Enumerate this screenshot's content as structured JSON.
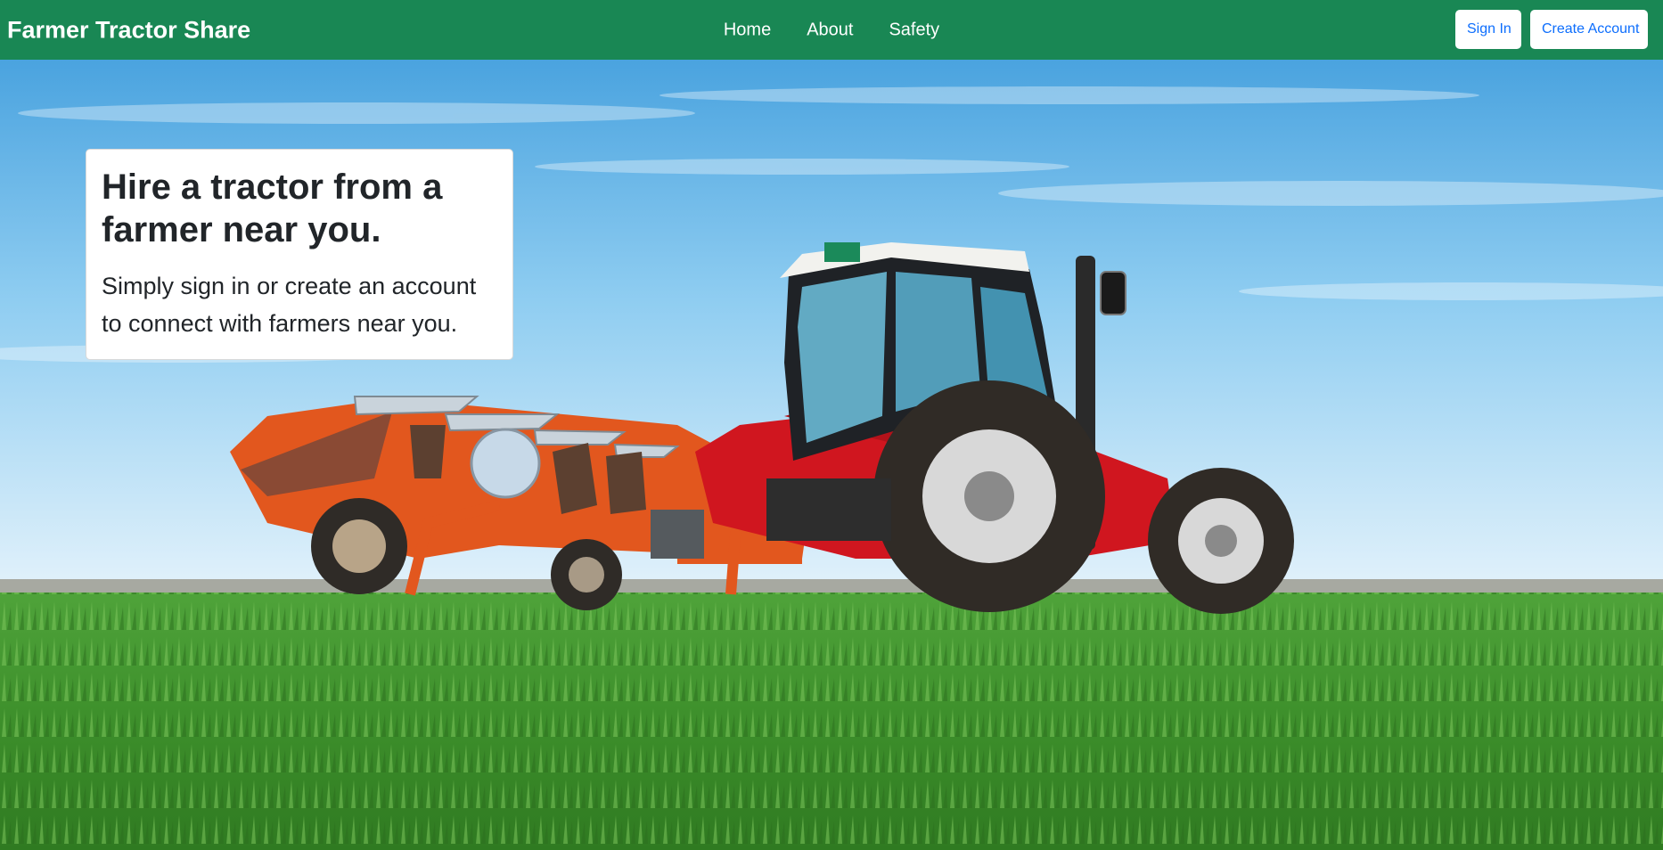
{
  "navbar": {
    "brand": "Farmer Tractor Share",
    "links": [
      {
        "label": "Home"
      },
      {
        "label": "About"
      },
      {
        "label": "Safety"
      }
    ],
    "actions": {
      "sign_in": "Sign In",
      "create_account": "Create Account"
    },
    "colors": {
      "background": "#198754",
      "button_text": "#0d6efd"
    }
  },
  "hero": {
    "title": "Hire a tractor from a farmer near you.",
    "text": "Simply sign in or create an account to connect with farmers near you.",
    "image_subject": "red tractor pulling an orange plow across a green field under a blue sky"
  }
}
